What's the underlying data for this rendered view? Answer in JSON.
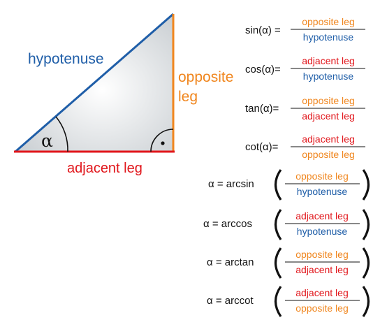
{
  "triangle": {
    "hypotenuse_label": "hypotenuse",
    "opposite_label_line1": "opposite",
    "opposite_label_line2": "leg",
    "adjacent_label": "adjacent leg",
    "angle_symbol": "α",
    "right_angle_mark": "•"
  },
  "colors": {
    "hypotenuse": "#1f5ea8",
    "opposite": "#f0861e",
    "adjacent": "#e1161b",
    "fill": "#d9dde0"
  },
  "formulas": [
    {
      "lhs": "sin(α) =",
      "num": "opposite leg",
      "den": "hypotenuse"
    },
    {
      "lhs": "cos(α)=",
      "num": "adjacent leg",
      "den": "hypotenuse"
    },
    {
      "lhs": "tan(α)=",
      "num": "opposite leg",
      "den": "adjacent leg"
    },
    {
      "lhs": "cot(α)=",
      "num": "adjacent leg",
      "den": "opposite leg"
    }
  ],
  "inverse": [
    {
      "lhs": "α =  arcsin",
      "num": "opposite leg",
      "den": "hypotenuse"
    },
    {
      "lhs": "α =  arccos",
      "num": "adjacent leg",
      "den": "hypotenuse"
    },
    {
      "lhs": "α =  arctan",
      "num": "opposite leg",
      "den": "adjacent leg"
    },
    {
      "lhs": "α =  arccot",
      "num": "adjacent leg",
      "den": "opposite leg"
    }
  ]
}
